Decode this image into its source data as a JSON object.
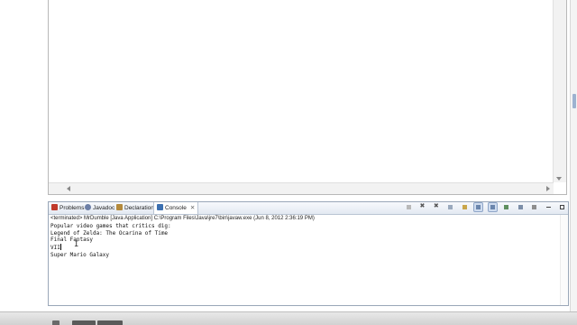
{
  "editor": {},
  "console_view": {
    "tabs": [
      {
        "label": "Problems",
        "icon": "problems-icon",
        "icon_color": "#c0392b"
      },
      {
        "label": "Javadoc",
        "icon": "javadoc-icon",
        "icon_color": "#6d7fa6"
      },
      {
        "label": "Declaration",
        "icon": "declaration-icon",
        "icon_color": "#b48a3c"
      },
      {
        "label": "Console",
        "icon": "console-icon",
        "icon_color": "#3b6fb0",
        "active": true
      }
    ],
    "status": "<terminated> MrDumble [Java Application] C:\\Program Files\\Java\\jre7\\bin\\javaw.exe (Jun 8, 2012 2:36:19 PM)",
    "output_lines": [
      "Popular video games that critics dig:",
      "Legend of Zelda: The Ocarina of Time",
      "Final Fantasy",
      "VII",
      "Super Mario Galaxy"
    ],
    "toolbar_icons": [
      "terminate-icon",
      "remove-launch-icon",
      "remove-all-icon",
      "scroll-lock-icon",
      "show-console-icon",
      "pin-console-icon",
      "word-wrap-icon",
      "open-console-icon",
      "display-console-icon",
      "new-console-icon",
      "minimize-icon",
      "maximize-icon"
    ]
  },
  "colors": {
    "accent": "#3b6fb0",
    "tab_border": "#b9c4d3"
  }
}
